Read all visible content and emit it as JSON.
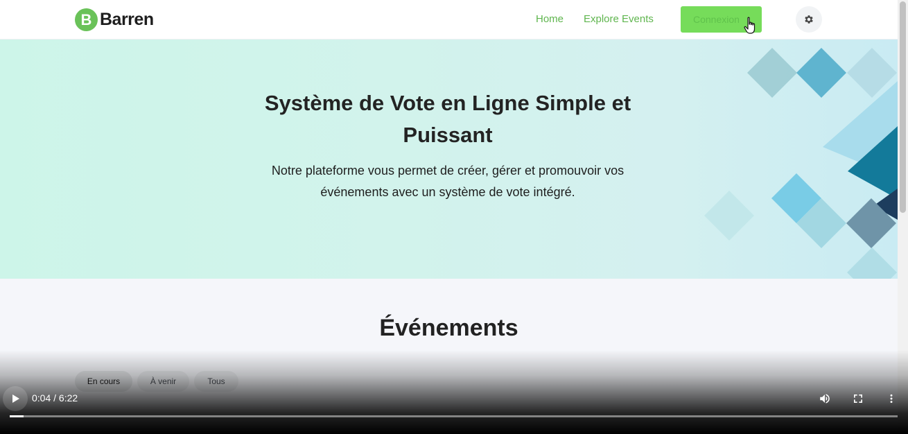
{
  "header": {
    "logo_letter": "B",
    "logo_text": "Barren",
    "nav": [
      {
        "label": "Home"
      },
      {
        "label": "Explore Events"
      }
    ],
    "login_label": "Connexion",
    "theme_icon": "gear-icon",
    "brand_color": "#6ac259",
    "link_color": "#5fb54e"
  },
  "hero": {
    "title": "Système de Vote en Ligne Simple et Puissant",
    "subtitle": "Notre plateforme vous permet de créer, gérer et promouvoir vos événements avec un système de vote intégré."
  },
  "events": {
    "title": "Événements",
    "filters": [
      {
        "label": "En cours",
        "active": true
      },
      {
        "label": "À venir",
        "active": false
      },
      {
        "label": "Tous",
        "active": false
      }
    ]
  },
  "video": {
    "time": "0:04 / 6:22",
    "progress_fraction": 0.0107,
    "icons": [
      "play-icon",
      "volume-icon",
      "fullscreen-icon",
      "more-vert-icon"
    ]
  }
}
